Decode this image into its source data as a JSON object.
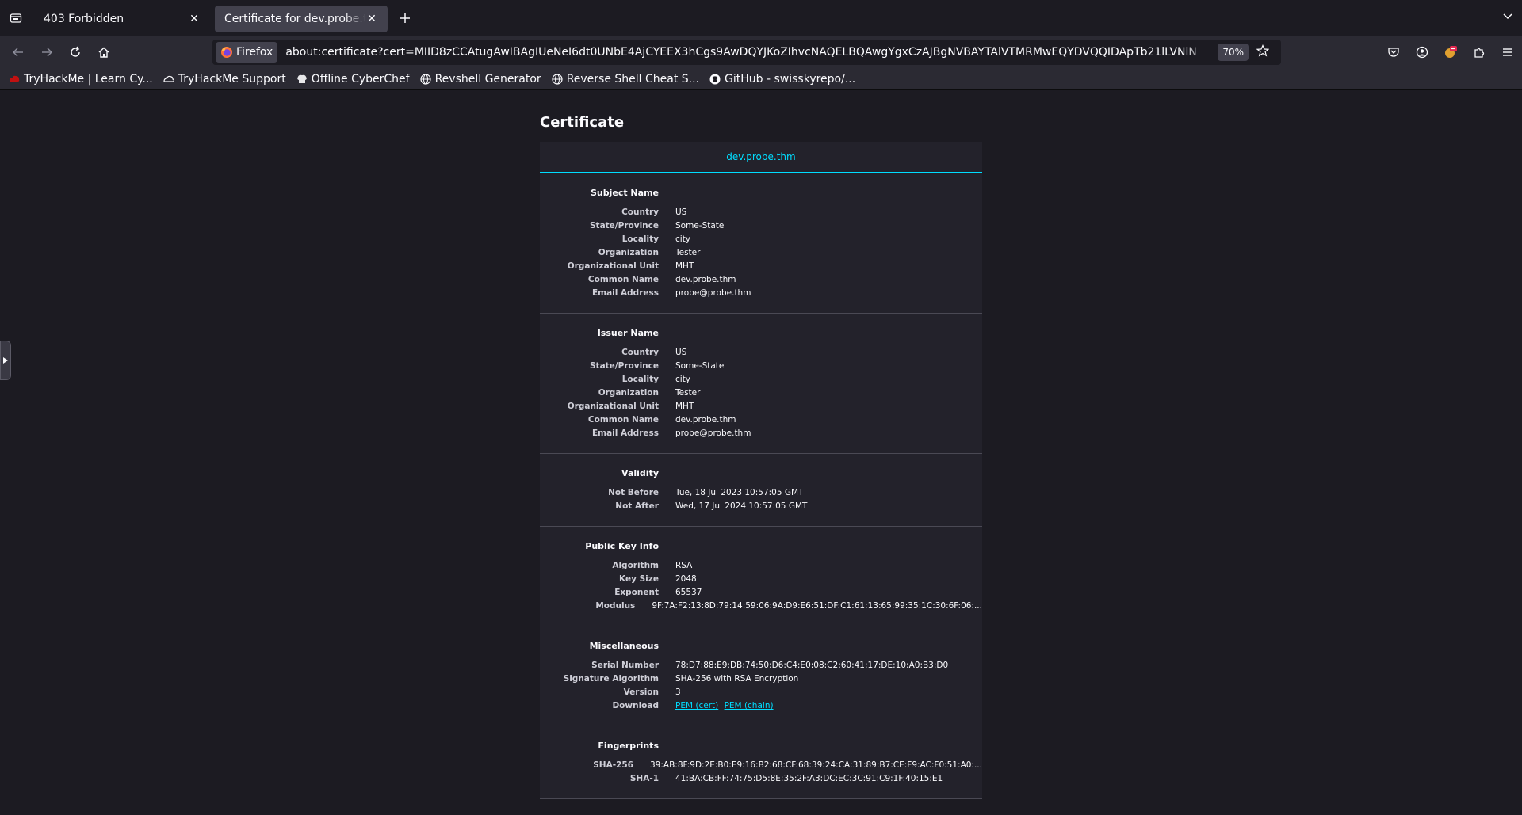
{
  "tabs": [
    {
      "label": "403 Forbidden",
      "active": false
    },
    {
      "label": "Certificate for dev.probe.thm",
      "active": true
    }
  ],
  "urlbar": {
    "identity_label": "Firefox",
    "url": "about:certificate?cert=MIID8zCCAtugAwIBAgIUeNeI6dt0UNbE4AjCYEEX3hCgs9AwDQYJKoZIhvcNAQELBQAwgYgxCzAJBgNVBAYTAlVTMRMwEQYDVQQIDApTb21lLVNlN",
    "zoom": "70%"
  },
  "bookmarks": [
    {
      "label": "TryHackMe | Learn Cy...",
      "icon": "tryhackme-icon"
    },
    {
      "label": "TryHackMe Support",
      "icon": "cloud-icon"
    },
    {
      "label": "Offline CyberChef",
      "icon": "chef-hat-icon"
    },
    {
      "label": "Revshell Generator",
      "icon": "globe-icon"
    },
    {
      "label": "Reverse Shell Cheat S...",
      "icon": "globe-icon"
    },
    {
      "label": "GitHub - swisskyrepo/...",
      "icon": "github-icon"
    }
  ],
  "page": {
    "title": "Certificate",
    "cert_tab": "dev.probe.thm"
  },
  "sections": {
    "subject": {
      "title": "Subject Name",
      "rows": [
        {
          "k": "Country",
          "v": "US"
        },
        {
          "k": "State/Province",
          "v": "Some-State"
        },
        {
          "k": "Locality",
          "v": "city"
        },
        {
          "k": "Organization",
          "v": "Tester"
        },
        {
          "k": "Organizational Unit",
          "v": "MHT"
        },
        {
          "k": "Common Name",
          "v": "dev.probe.thm"
        },
        {
          "k": "Email Address",
          "v": "probe@probe.thm"
        }
      ]
    },
    "issuer": {
      "title": "Issuer Name",
      "rows": [
        {
          "k": "Country",
          "v": "US"
        },
        {
          "k": "State/Province",
          "v": "Some-State"
        },
        {
          "k": "Locality",
          "v": "city"
        },
        {
          "k": "Organization",
          "v": "Tester"
        },
        {
          "k": "Organizational Unit",
          "v": "MHT"
        },
        {
          "k": "Common Name",
          "v": "dev.probe.thm"
        },
        {
          "k": "Email Address",
          "v": "probe@probe.thm"
        }
      ]
    },
    "validity": {
      "title": "Validity",
      "rows": [
        {
          "k": "Not Before",
          "v": "Tue, 18 Jul 2023 10:57:05 GMT"
        },
        {
          "k": "Not After",
          "v": "Wed, 17 Jul 2024 10:57:05 GMT"
        }
      ]
    },
    "pubkey": {
      "title": "Public Key Info",
      "rows": [
        {
          "k": "Algorithm",
          "v": "RSA"
        },
        {
          "k": "Key Size",
          "v": "2048"
        },
        {
          "k": "Exponent",
          "v": "65537"
        },
        {
          "k": "Modulus",
          "v": "9F:7A:F2:13:8D:79:14:59:06:9A:D9:E6:51:DF:C1:61:13:65:99:35:1C:30:6F:06:..."
        }
      ]
    },
    "misc": {
      "title": "Miscellaneous",
      "rows": [
        {
          "k": "Serial Number",
          "v": "78:D7:88:E9:DB:74:50:D6:C4:E0:08:C2:60:41:17:DE:10:A0:B3:D0"
        },
        {
          "k": "Signature Algorithm",
          "v": "SHA-256 with RSA Encryption"
        },
        {
          "k": "Version",
          "v": "3"
        }
      ],
      "download_label": "Download",
      "download_links": [
        "PEM (cert)",
        "PEM (chain)"
      ]
    },
    "fingerprints": {
      "title": "Fingerprints",
      "rows": [
        {
          "k": "SHA-256",
          "v": "39:AB:8F:9D:2E:B0:E9:16:B2:68:CF:68:39:24:CA:31:89:B7:CE:F9:AC:F0:51:A0:..."
        },
        {
          "k": "SHA-1",
          "v": "41:BA:CB:FF:74:75:D5:8E:35:2F:A3:DC:EC:3C:91:C9:1F:40:15:E1"
        }
      ]
    }
  },
  "colors": {
    "accent": "#00ddff",
    "page_bg": "#1c1b22",
    "panel_bg": "#23222b"
  }
}
